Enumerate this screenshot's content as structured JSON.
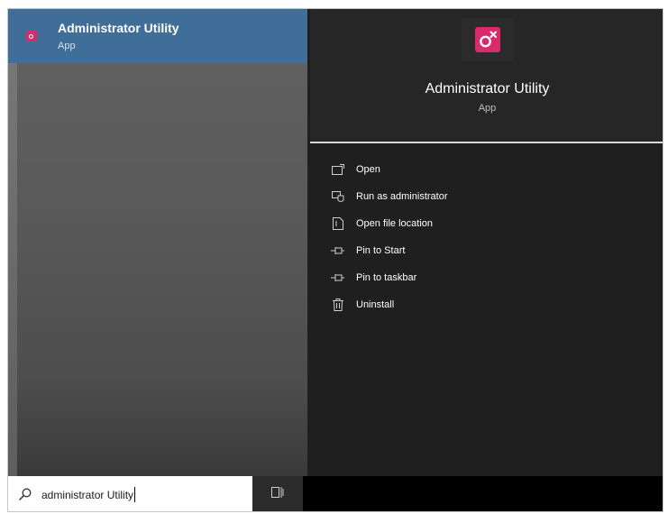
{
  "search_result": {
    "title": "Administrator Utility",
    "type_label": "App",
    "icon": "admin-utility-app-icon"
  },
  "details": {
    "title": "Administrator Utility",
    "type_label": "App",
    "icon": "admin-utility-app-icon"
  },
  "actions": [
    {
      "label": "Open",
      "icon": "open-icon"
    },
    {
      "label": "Run as administrator",
      "icon": "run-as-admin-icon"
    },
    {
      "label": "Open file location",
      "icon": "file-location-icon"
    },
    {
      "label": "Pin to Start",
      "icon": "pin-icon"
    },
    {
      "label": "Pin to taskbar",
      "icon": "pin-icon"
    },
    {
      "label": "Uninstall",
      "icon": "trash-icon"
    }
  ],
  "search": {
    "value": "administrator Utility",
    "icon": "search-icon"
  },
  "taskbar": {
    "task_view_icon": "task-view-icon"
  },
  "colors": {
    "accent": "#3f6f99",
    "brand_icon": "#d92a6b",
    "panel": "#1f1f1f"
  }
}
